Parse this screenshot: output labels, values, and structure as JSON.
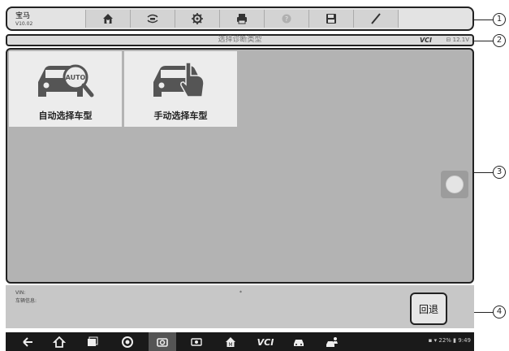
{
  "header": {
    "app_name": "宝马",
    "version": "V10.02",
    "toolbar": [
      {
        "name": "home-icon"
      },
      {
        "name": "vehicle-swap-icon"
      },
      {
        "name": "settings-icon"
      },
      {
        "name": "print-icon"
      },
      {
        "name": "help-icon"
      },
      {
        "name": "save-icon"
      },
      {
        "name": "pen-icon"
      }
    ]
  },
  "subheader": {
    "title": "选择诊断类型",
    "vci_label": "VCI",
    "battery_voltage": "12.1V"
  },
  "tiles": [
    {
      "label": "自动选择车型",
      "icon": "car-auto-search-icon"
    },
    {
      "label": "手动选择车型",
      "icon": "car-manual-touch-icon"
    }
  ],
  "info": {
    "vin_label": "VIN:",
    "vehicle_info_label": "车辆信息:",
    "marker": "*"
  },
  "back_button": "回退",
  "status": {
    "battery": "22%",
    "time": "9:49"
  },
  "callouts": [
    "1",
    "2",
    "3",
    "4"
  ]
}
